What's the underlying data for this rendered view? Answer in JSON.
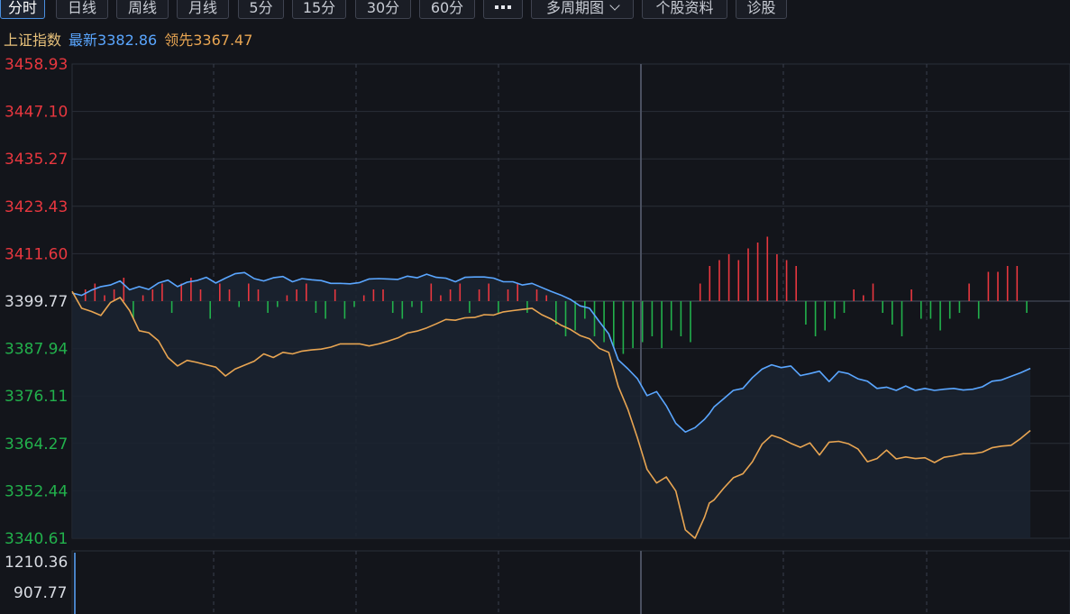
{
  "tabs": [
    {
      "label": "分时",
      "active": true
    },
    {
      "label": "日线"
    },
    {
      "label": "周线"
    },
    {
      "label": "月线"
    },
    {
      "label": "5分"
    },
    {
      "label": "15分"
    },
    {
      "label": "30分"
    },
    {
      "label": "60分"
    },
    {
      "label": "",
      "icon": "more-dots-icon"
    },
    {
      "label": "多周期图",
      "icon": "chevron-down-icon"
    },
    {
      "label": "个股资料"
    },
    {
      "label": "诊股"
    }
  ],
  "info": {
    "index_name": "上证指数",
    "latest_label": "最新",
    "latest_value": "3382.86",
    "lead_label": "领先",
    "lead_value": "3367.47"
  },
  "colors": {
    "up": "#e8373f",
    "down": "#22b14c",
    "price_line": "#5aa6ff",
    "lead_line": "#e8a552",
    "grid": "#2a2e38",
    "bg": "#13151b"
  },
  "chart_data": {
    "type": "line",
    "ylim": [
      3340.61,
      3458.93
    ],
    "base": 3399.77,
    "price_ticks": [
      "3458.93",
      "3447.10",
      "3435.27",
      "3423.43",
      "3411.60",
      "3399.77",
      "3387.94",
      "3376.11",
      "3364.27",
      "3352.44",
      "3340.61"
    ],
    "volume_ticks": [
      "1210.36",
      "907.77"
    ],
    "series": [
      {
        "key": "latest",
        "x": [
          0.0,
          0.01,
          0.02,
          0.03,
          0.04,
          0.05,
          0.06,
          0.07,
          0.08,
          0.09,
          0.1,
          0.11,
          0.12,
          0.13,
          0.14,
          0.15,
          0.16,
          0.17,
          0.18,
          0.19,
          0.2,
          0.21,
          0.22,
          0.23,
          0.24,
          0.25,
          0.26,
          0.27,
          0.28,
          0.29,
          0.3,
          0.31,
          0.32,
          0.33,
          0.34,
          0.35,
          0.36,
          0.37,
          0.38,
          0.39,
          0.4,
          0.41,
          0.42,
          0.43,
          0.44,
          0.45,
          0.46,
          0.47,
          0.48,
          0.49,
          0.5,
          0.51,
          0.52,
          0.53,
          0.54,
          0.55,
          0.56,
          0.57,
          0.58,
          0.59,
          0.6,
          0.61,
          0.62,
          0.63,
          0.64,
          0.65,
          0.66,
          0.665,
          0.67,
          0.68,
          0.69,
          0.7,
          0.71,
          0.72,
          0.73,
          0.74,
          0.75,
          0.76,
          0.77,
          0.78,
          0.79,
          0.8,
          0.81,
          0.82,
          0.83,
          0.84,
          0.85,
          0.86,
          0.87,
          0.88,
          0.89,
          0.9,
          0.91,
          0.92,
          0.93,
          0.94,
          0.95,
          0.96,
          0.97,
          0.98,
          0.99,
          1.0
        ],
        "values": [
          3401.8,
          3401.2,
          3402.5,
          3403.4,
          3403.8,
          3404.8,
          3402.6,
          3403.4,
          3402.7,
          3404.3,
          3405.0,
          3403.4,
          3404.5,
          3404.9,
          3405.7,
          3404.3,
          3405.5,
          3406.6,
          3406.9,
          3405.4,
          3404.8,
          3405.6,
          3405.9,
          3404.6,
          3405.4,
          3405.1,
          3404.9,
          3404.2,
          3404.2,
          3404.1,
          3404.4,
          3405.3,
          3405.4,
          3405.3,
          3405.2,
          3406.0,
          3405.6,
          3406.5,
          3405.7,
          3405.5,
          3404.6,
          3405.7,
          3405.8,
          3405.8,
          3405.5,
          3404.6,
          3404.6,
          3403.8,
          3404.2,
          3403.2,
          3402.2,
          3401.3,
          3400.2,
          3398.6,
          3398.0,
          3394.7,
          3391.6,
          3385.1,
          3382.9,
          3380.4,
          3376.2,
          3377.2,
          3373.7,
          3369.3,
          3367.1,
          3368.2,
          3370.3,
          3371.7,
          3373.4,
          3375.4,
          3377.5,
          3378.0,
          3380.7,
          3382.8,
          3383.9,
          3383.2,
          3383.6,
          3381.2,
          3381.7,
          3382.3,
          3379.7,
          3382.2,
          3381.7,
          3380.4,
          3379.8,
          3378.0,
          3378.3,
          3377.5,
          3378.6,
          3377.5,
          3378.0,
          3377.5,
          3377.8,
          3378.0,
          3377.6,
          3377.8,
          3378.4,
          3379.8,
          3380.1,
          3381.0,
          3381.9,
          3383.0
        ]
      },
      {
        "key": "lead",
        "x": [
          0.0,
          0.01,
          0.02,
          0.03,
          0.04,
          0.05,
          0.06,
          0.07,
          0.08,
          0.09,
          0.1,
          0.11,
          0.12,
          0.13,
          0.14,
          0.15,
          0.16,
          0.17,
          0.18,
          0.19,
          0.2,
          0.21,
          0.22,
          0.23,
          0.24,
          0.25,
          0.26,
          0.27,
          0.28,
          0.29,
          0.3,
          0.31,
          0.32,
          0.33,
          0.34,
          0.35,
          0.36,
          0.37,
          0.38,
          0.39,
          0.4,
          0.41,
          0.42,
          0.43,
          0.44,
          0.45,
          0.46,
          0.47,
          0.48,
          0.49,
          0.5,
          0.51,
          0.52,
          0.53,
          0.54,
          0.55,
          0.56,
          0.57,
          0.58,
          0.59,
          0.6,
          0.61,
          0.62,
          0.63,
          0.64,
          0.65,
          0.66,
          0.665,
          0.67,
          0.68,
          0.69,
          0.7,
          0.71,
          0.72,
          0.73,
          0.74,
          0.75,
          0.76,
          0.77,
          0.78,
          0.79,
          0.8,
          0.81,
          0.82,
          0.83,
          0.84,
          0.85,
          0.86,
          0.87,
          0.88,
          0.89,
          0.9,
          0.91,
          0.92,
          0.93,
          0.94,
          0.95,
          0.96,
          0.97,
          0.98,
          0.99,
          1.0
        ],
        "values": [
          3402.2,
          3398.0,
          3397.2,
          3396.2,
          3399.4,
          3400.7,
          3397.4,
          3392.4,
          3391.9,
          3389.9,
          3385.7,
          3383.6,
          3385.0,
          3384.5,
          3383.9,
          3383.3,
          3381.1,
          3382.8,
          3383.8,
          3384.8,
          3386.6,
          3385.7,
          3387.0,
          3386.6,
          3387.3,
          3387.6,
          3387.8,
          3388.3,
          3389.1,
          3389.1,
          3389.1,
          3388.6,
          3389.1,
          3389.8,
          3390.6,
          3391.8,
          3392.3,
          3393.1,
          3394.1,
          3395.2,
          3395.0,
          3395.6,
          3395.7,
          3396.4,
          3396.3,
          3397.1,
          3397.4,
          3397.7,
          3398.0,
          3396.4,
          3395.3,
          3393.8,
          3392.7,
          3391.2,
          3390.4,
          3388.0,
          3387.0,
          3378.5,
          3372.8,
          3365.6,
          3357.8,
          3354.4,
          3355.9,
          3352.4,
          3342.7,
          3340.6,
          3345.9,
          3349.4,
          3350.2,
          3353.1,
          3355.7,
          3356.7,
          3359.7,
          3364.1,
          3366.3,
          3365.5,
          3364.3,
          3363.3,
          3364.4,
          3361.4,
          3364.6,
          3364.8,
          3364.2,
          3362.9,
          3359.7,
          3360.5,
          3362.6,
          3360.4,
          3360.9,
          3360.5,
          3360.7,
          3359.5,
          3360.8,
          3361.2,
          3361.7,
          3361.7,
          3362.1,
          3363.2,
          3363.6,
          3363.8,
          3365.5,
          3367.5
        ]
      }
    ],
    "bars": [
      0,
      2,
      3,
      1,
      2,
      4,
      -3,
      1,
      2,
      3,
      -2,
      3,
      4,
      2,
      -3,
      3,
      2,
      -1,
      3,
      2,
      -2,
      -1,
      1,
      2,
      3,
      -2,
      -3,
      2,
      -3,
      -1,
      1,
      2,
      2,
      -2,
      -3,
      -1,
      -2,
      3,
      1,
      2,
      3,
      -2,
      2,
      3,
      -2,
      2,
      3,
      -2,
      2,
      1,
      -4,
      -6,
      -5,
      -3,
      -6,
      -7,
      -8,
      -9,
      -8,
      -7,
      -6,
      -8,
      -5,
      -6,
      -7,
      3,
      6,
      7,
      8,
      7,
      9,
      10,
      11,
      8,
      7,
      6,
      -4,
      -6,
      -5,
      -3,
      -2,
      2,
      1,
      3,
      -2,
      -4,
      -6,
      2,
      -3,
      -3,
      -5,
      -3,
      -2,
      3,
      -3,
      5,
      5,
      6,
      6,
      -2
    ]
  }
}
